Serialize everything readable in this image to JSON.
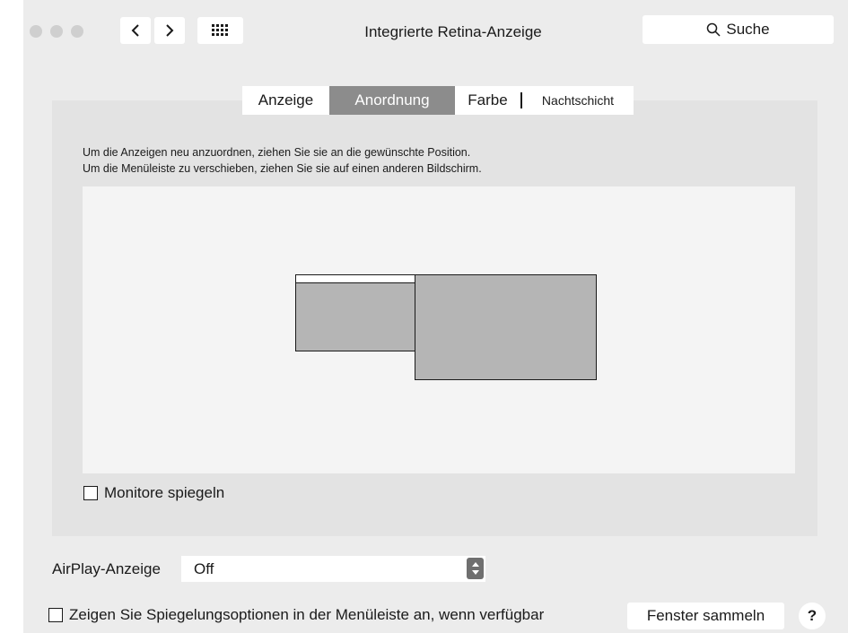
{
  "window": {
    "title": "Integrierte Retina-Anzeige"
  },
  "toolbar": {
    "back_icon": "chevron-left-icon",
    "forward_icon": "chevron-right-icon",
    "grid_icon": "grid-icon",
    "search_placeholder": "Suche",
    "search_icon": "search-icon"
  },
  "tabs": [
    {
      "label": "Anzeige",
      "selected": false
    },
    {
      "label": "Anordnung",
      "selected": true
    },
    {
      "label": "Farbe",
      "selected": false
    },
    {
      "label": "Nachtschicht",
      "selected": false
    }
  ],
  "arrangement": {
    "instruction_line1": "Um die Anzeigen neu anzuordnen, ziehen Sie sie an die gewünschte Position.",
    "instruction_line2": "Um die Menüleiste zu verschieben, ziehen Sie sie auf einen anderen Bildschirm.",
    "mirror_label": "Monitore spiegeln",
    "mirror_checked": false
  },
  "airplay": {
    "label": "AirPlay-Anzeige",
    "value": "Off"
  },
  "footer": {
    "menu_option_label": "Zeigen Sie Spiegelungsoptionen in der Menüleiste an, wenn verfügbar",
    "menu_option_checked": false,
    "gather_button": "Fenster sammeln",
    "help_button": "?"
  },
  "colors": {
    "selected_tab": "#8c8c8c",
    "display_fill": "#b5b5b5",
    "window_bg": "#ececec"
  }
}
